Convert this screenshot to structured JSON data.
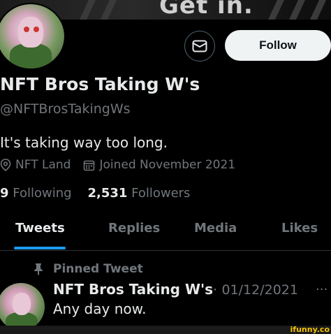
{
  "banner": {
    "text": "Get in."
  },
  "profile": {
    "display_name": "NFT Bros Taking W's",
    "handle": "@NFTBrosTakingWs",
    "bio": "It's taking way too long.",
    "location": "NFT Land",
    "joined": "Joined November 2021",
    "following_count": "9",
    "following_label": "Following",
    "followers_count": "2,531",
    "followers_label": "Followers"
  },
  "actions": {
    "message_icon": "envelope-icon",
    "follow_label": "Follow"
  },
  "tabs": [
    {
      "label": "Tweets",
      "active": true
    },
    {
      "label": "Replies",
      "active": false
    },
    {
      "label": "Media",
      "active": false
    },
    {
      "label": "Likes",
      "active": false
    }
  ],
  "pinned": {
    "label": "Pinned Tweet",
    "icon": "pin-icon",
    "author": "NFT Bros Taking W's",
    "separator": "·",
    "date": "01/12/2021",
    "text": "Any day now.",
    "more_icon": "more-icon"
  },
  "watermark": "ifunny.co",
  "colors": {
    "background": "#000000",
    "accent": "#1d9bf0",
    "secondary_text": "#71767b",
    "follow_button": "#eff3f4"
  }
}
